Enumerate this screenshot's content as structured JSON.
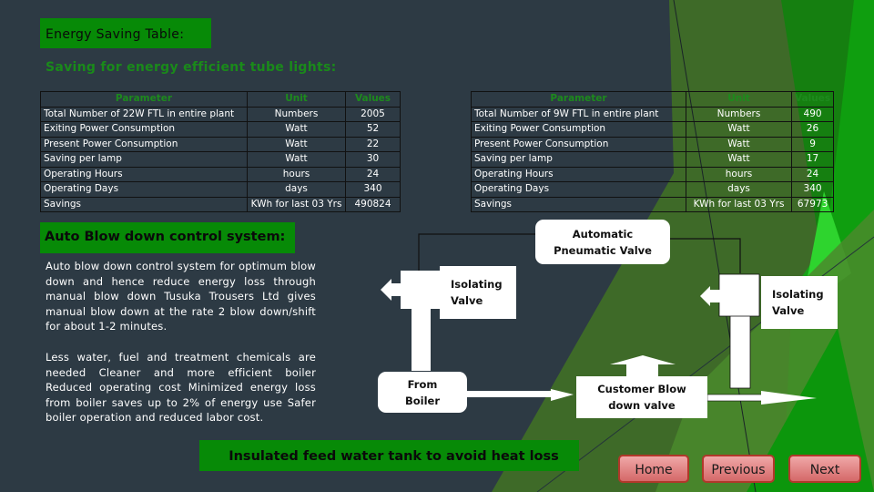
{
  "page": {
    "title": "Energy Saving Table:",
    "subtitle": "Saving for energy efficient tube lights:"
  },
  "table_22w": {
    "headers": [
      "Parameter",
      "Unit",
      "Values"
    ],
    "rows": [
      [
        "Total Number of 22W FTL in entire plant",
        "Numbers",
        "2005"
      ],
      [
        "Exiting Power Consumption",
        "Watt",
        "52"
      ],
      [
        "Present Power Consumption",
        "Watt",
        "22"
      ],
      [
        "Saving per lamp",
        "Watt",
        "30"
      ],
      [
        "Operating Hours",
        "hours",
        "24"
      ],
      [
        "Operating Days",
        "days",
        "340"
      ],
      [
        "Savings",
        "KWh for last 03 Yrs",
        "490824"
      ]
    ]
  },
  "table_9w": {
    "headers": [
      "Parameter",
      "Unit",
      "Values"
    ],
    "rows": [
      [
        "Total Number of 9W FTL in entire plant",
        "Numbers",
        "490"
      ],
      [
        "Exiting Power Consumption",
        "Watt",
        "26"
      ],
      [
        "Present Power Consumption",
        "Watt",
        "9"
      ],
      [
        "Saving per lamp",
        "Watt",
        "17"
      ],
      [
        "Operating Hours",
        "hours",
        "24"
      ],
      [
        "Operating Days",
        "days",
        "340"
      ],
      [
        "Savings",
        "KWh for last 03 Yrs",
        "67973"
      ]
    ]
  },
  "blowdown": {
    "title": "Auto Blow down control system:",
    "paragraph1": "Auto blow down control system for optimum blow down and hence reduce energy loss through manual blow down Tusuka Trousers Ltd gives manual blow down at the rate 2 blow down/shift for about 1-2 minutes.",
    "paragraph2": "Less water, fuel and treatment chemicals are needed Cleaner and more efficient boiler Reduced operating cost Minimized energy loss from boiler saves up to 2% of energy use Safer boiler operation and reduced labor cost."
  },
  "diagram": {
    "auto_valve": "Automatic Pneumatic Valve",
    "isolating_left": "Isolating Valve",
    "isolating_right": "Isolating Valve",
    "from_boiler": "From Boiler",
    "customer_valve": "Customer Blow down valve"
  },
  "insulated_label": "Insulated feed water tank to avoid heat loss",
  "nav": {
    "home": "Home",
    "previous": "Previous",
    "next": "Next"
  },
  "colors": {
    "background": "#2d3a44",
    "accent_green": "#078a07",
    "header_text_green": "#1d8a1d",
    "nav_button": "#e08080"
  }
}
